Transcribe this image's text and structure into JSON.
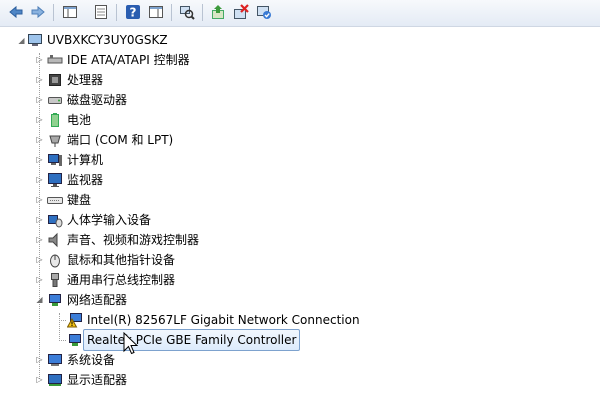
{
  "toolbar": {
    "buttons": [
      {
        "name": "back-icon"
      },
      {
        "name": "forward-icon"
      },
      {
        "name": "show-hide-console-tree-icon"
      },
      {
        "name": "properties-icon"
      },
      {
        "name": "help-icon"
      },
      {
        "name": "action-pane-icon"
      },
      {
        "name": "scan-hardware-icon"
      },
      {
        "name": "update-driver-icon"
      },
      {
        "name": "uninstall-icon"
      },
      {
        "name": "enable-device-icon"
      }
    ]
  },
  "tree": {
    "root": "UVBXKCY3UY0GSKZ",
    "categories": [
      {
        "label": "IDE ATA/ATAPI 控制器",
        "icon": "ide-controller-icon"
      },
      {
        "label": "处理器",
        "icon": "processor-icon"
      },
      {
        "label": "磁盘驱动器",
        "icon": "disk-drive-icon"
      },
      {
        "label": "电池",
        "icon": "battery-icon"
      },
      {
        "label": "端口 (COM 和 LPT)",
        "icon": "port-icon"
      },
      {
        "label": "计算机",
        "icon": "computer-icon"
      },
      {
        "label": "监视器",
        "icon": "monitor-icon"
      },
      {
        "label": "键盘",
        "icon": "keyboard-icon"
      },
      {
        "label": "人体学输入设备",
        "icon": "hid-icon"
      },
      {
        "label": "声音、视频和游戏控制器",
        "icon": "sound-icon"
      },
      {
        "label": "鼠标和其他指针设备",
        "icon": "mouse-icon"
      },
      {
        "label": "通用串行总线控制器",
        "icon": "usb-icon"
      },
      {
        "label": "网络适配器",
        "icon": "network-adapter-icon"
      }
    ],
    "network_children": [
      {
        "label": "Intel(R) 82567LF Gigabit Network Connection",
        "icon": "network-warning-icon"
      },
      {
        "label": "Realtek PCIe GBE Family Controller",
        "icon": "network-card-icon"
      }
    ],
    "after": [
      {
        "label": "系统设备",
        "icon": "system-devices-icon"
      },
      {
        "label": "显示适配器",
        "icon": "display-adapter-icon"
      }
    ]
  },
  "colors": {
    "selection_border": "#7da2ce",
    "toolbar_bg": "#e4ebf5",
    "help_blue": "#2a5db0"
  }
}
